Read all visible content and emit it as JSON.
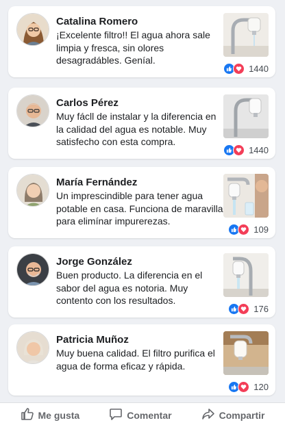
{
  "comments": [
    {
      "name": "Catalina Romero",
      "text": "¡Excelente filtro!! El agua ahora sale limpia y fresca, sin olores desagradábles. Geníal.",
      "reactions": "1440",
      "avatar": "woman-glasses-avatar",
      "image": "faucet-filter-photo"
    },
    {
      "name": "Carlos Pérez",
      "text": "Muy fácll de instalar y la diferencia en la calidad del agua es notable. Muy satisfecho con esta compra.",
      "reactions": "1440",
      "avatar": "man-glasses-avatar",
      "image": "faucet-filter-photo"
    },
    {
      "name": "María Fernández",
      "text": "Un imprescindible para tener agua potable en casa. Funciona de maravilla para elimínar impurerezas.",
      "reactions": "109",
      "avatar": "woman-avatar",
      "image": "faucet-filter-water-photo"
    },
    {
      "name": "Jorge González",
      "text": "Buen producto. La diferencia en el sabor del agua es notoria. Muy contento con los resultados.",
      "reactions": "176",
      "avatar": "man-beard-avatar",
      "image": "faucet-filter-photo"
    },
    {
      "name": "Patricia Muñoz",
      "text": "Muy buena calidad. El filtro purifica el agua de forma eficaz y rápida.",
      "reactions": "120",
      "avatar": "older-woman-avatar",
      "image": "faucet-filter-photo"
    }
  ],
  "actions": {
    "like": "Me gusta",
    "comment": "Comentar",
    "share": "Compartir"
  },
  "colors": {
    "like_blue": "#1877f2",
    "love_red": "#f33e58",
    "action_gray": "#65676b"
  }
}
